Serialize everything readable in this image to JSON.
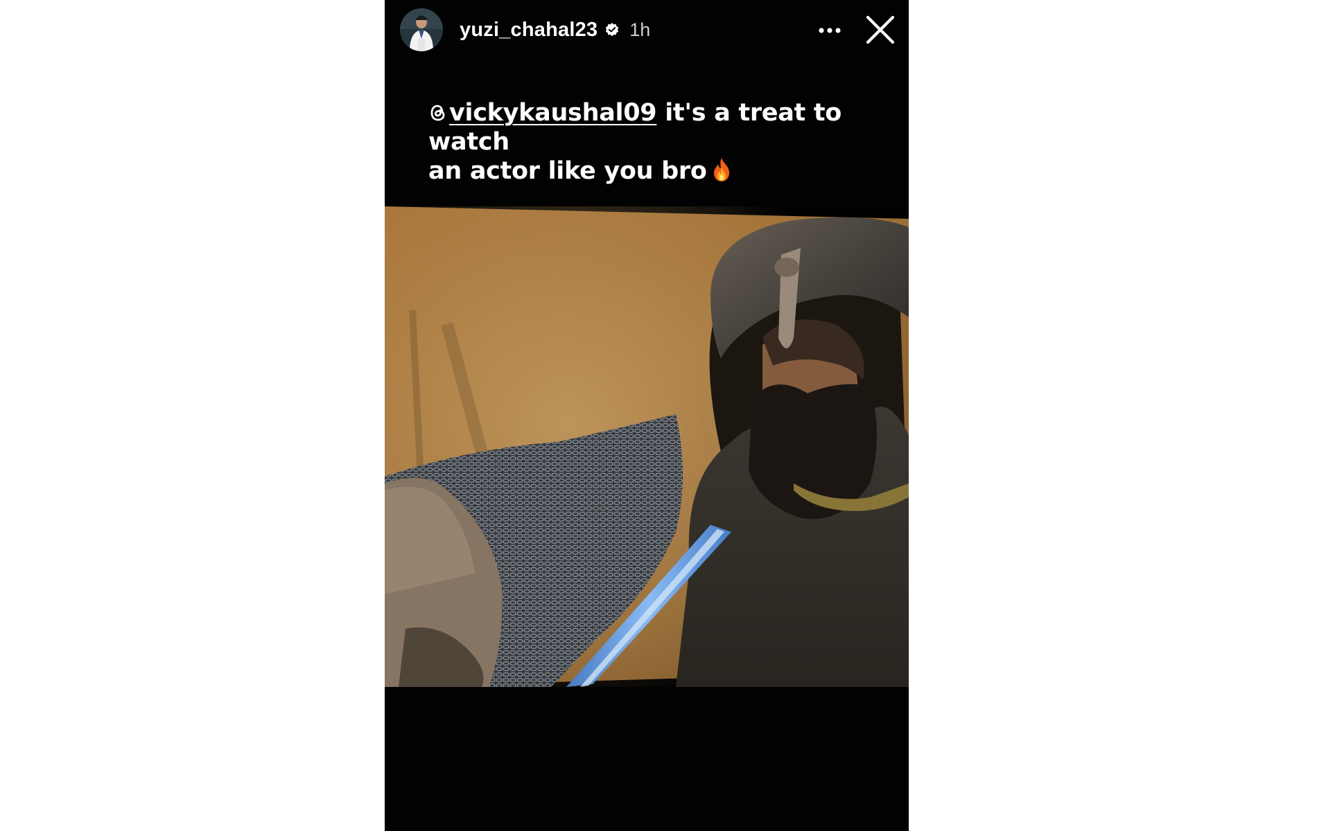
{
  "story": {
    "username": "yuzi_chahal23",
    "time": "1h",
    "verified": true,
    "caption": {
      "mention": "vickykaushal09",
      "line1_rest": " it's a treat to watch",
      "line2": "an actor like you bro"
    }
  },
  "icons": {
    "avatar": "profile-photo",
    "verified": "verified-badge-icon",
    "more": "more-horizontal-icon",
    "close": "close-icon",
    "mention_prefix": "threads-icon",
    "emoji": "fire-emoji-icon"
  },
  "colors": {
    "story_background": "#020202",
    "text": "#ffffff",
    "time_text": "#cfcfcf"
  }
}
